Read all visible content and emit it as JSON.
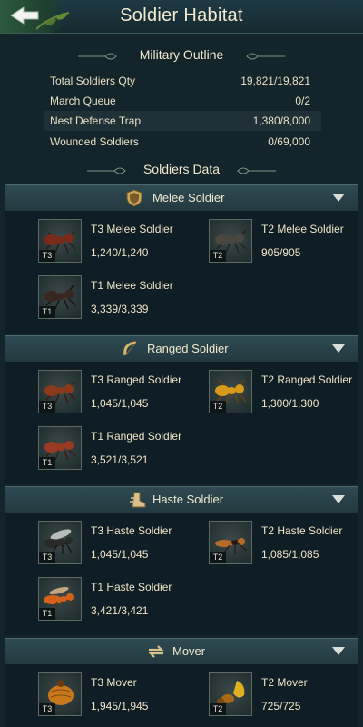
{
  "header": {
    "title": "Soldier Habitat"
  },
  "military_outline": {
    "heading": "Military Outline",
    "rows": [
      {
        "label": "Total Soldiers Qty",
        "value": "19,821/19,821"
      },
      {
        "label": "March Queue",
        "value": "0/2"
      },
      {
        "label": "Nest Defense Trap",
        "value": "1,380/8,000"
      },
      {
        "label": "Wounded Soldiers",
        "value": "0/69,000"
      }
    ]
  },
  "soldiers_data": {
    "heading": "Soldiers Data",
    "categories": [
      {
        "label": "Melee Soldier",
        "icon": "shield-icon",
        "soldiers": [
          {
            "tier": "T3",
            "name": "T3 Melee Soldier",
            "qty": "1,240/1,240",
            "color": "#7a2a18"
          },
          {
            "tier": "T2",
            "name": "T2 Melee Soldier",
            "qty": "905/905",
            "color": "#4a4640"
          },
          {
            "tier": "T1",
            "name": "T1 Melee Soldier",
            "qty": "3,339/3,339",
            "color": "#3a2620"
          }
        ]
      },
      {
        "label": "Ranged Soldier",
        "icon": "bow-icon",
        "soldiers": [
          {
            "tier": "T3",
            "name": "T3 Ranged Soldier",
            "qty": "1,045/1,045",
            "color": "#8a3a1a"
          },
          {
            "tier": "T2",
            "name": "T2 Ranged Soldier",
            "qty": "1,300/1,300",
            "color": "#d99a1a"
          },
          {
            "tier": "T1",
            "name": "T1 Ranged Soldier",
            "qty": "3,521/3,521",
            "color": "#9a3a22"
          }
        ]
      },
      {
        "label": "Haste Soldier",
        "icon": "boot-icon",
        "soldiers": [
          {
            "tier": "T3",
            "name": "T3 Haste Soldier",
            "qty": "1,045/1,045",
            "color": "#2a2a2a"
          },
          {
            "tier": "T2",
            "name": "T2 Haste Soldier",
            "qty": "1,085/1,085",
            "color": "#b86a2a"
          },
          {
            "tier": "T1",
            "name": "T1 Haste Soldier",
            "qty": "3,421/3,421",
            "color": "#d4621a"
          }
        ]
      },
      {
        "label": "Mover",
        "icon": "arrows-icon",
        "soldiers": [
          {
            "tier": "T3",
            "name": "T3 Mover",
            "qty": "1,945/1,945",
            "color": "#c8781a"
          },
          {
            "tier": "T2",
            "name": "T2 Mover",
            "qty": "725/725",
            "color": "#e0b020"
          }
        ]
      }
    ]
  }
}
